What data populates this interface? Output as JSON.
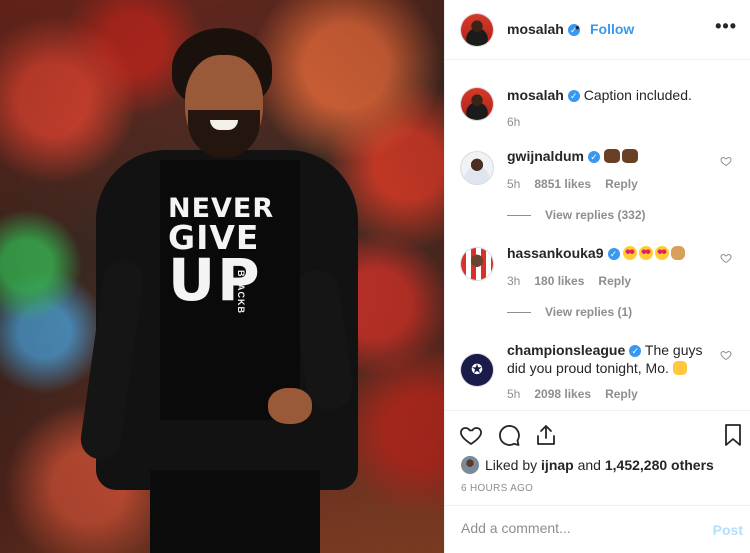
{
  "photo": {
    "shirt_line1": "NEVER",
    "shirt_line2": "GIVE",
    "shirt_line3": "UP",
    "shirt_tag": "BLACKB"
  },
  "header": {
    "username": "mosalah",
    "separator": "•",
    "follow_label": "Follow",
    "more_label": "•••"
  },
  "caption": {
    "username": "mosalah",
    "text": "Caption included.",
    "time": "6h"
  },
  "comments": [
    {
      "username": "gwijnaldum",
      "text": "",
      "time": "5h",
      "likes": "8851 likes",
      "reply": "Reply",
      "view_replies": "View replies (332)"
    },
    {
      "username": "hassankouka9",
      "text": "",
      "time": "3h",
      "likes": "180 likes",
      "reply": "Reply",
      "view_replies": "View replies (1)"
    },
    {
      "username": "championsleague",
      "text": "The guys did you proud tonight, Mo.",
      "time": "5h",
      "likes": "2098 likes",
      "reply": "Reply"
    }
  ],
  "likes": {
    "prefix": "Liked by",
    "user": "ijnap",
    "connector": "and",
    "count": "1,452,280 others"
  },
  "timestamp": "6 HOURS AGO",
  "add_comment": {
    "placeholder": "Add a comment...",
    "post_label": "Post"
  },
  "colors": {
    "accent": "#3897f0",
    "muted": "#8e8e8e",
    "post_disabled": "#b2dffc",
    "border": "#efefef"
  }
}
